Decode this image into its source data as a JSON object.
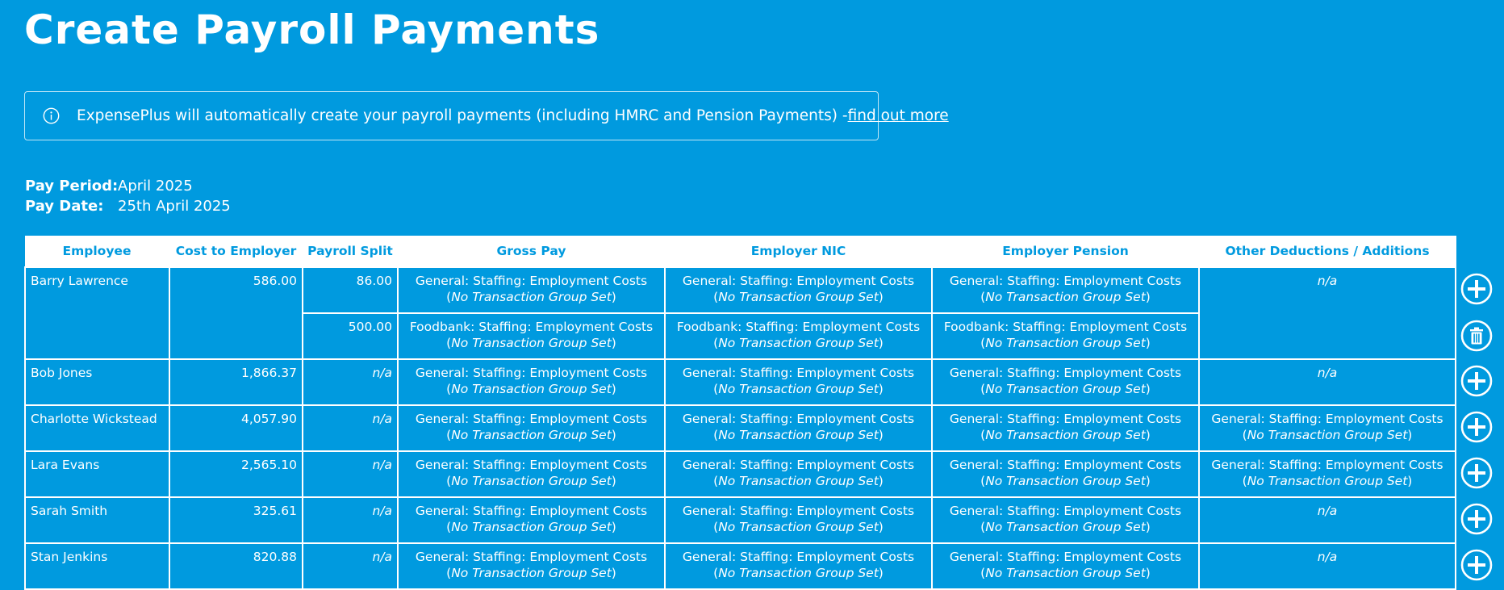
{
  "page": {
    "title": "Create Payroll Payments"
  },
  "banner": {
    "icon": "info-icon",
    "text": "ExpensePlus will automatically create your payroll payments (including HMRC and Pension Payments) - ",
    "link_text": "find out more"
  },
  "pay_info": {
    "period_label": "Pay Period:",
    "period_value": "April 2025",
    "date_label": "Pay Date:",
    "date_value": "25th April 2025"
  },
  "table": {
    "headers": {
      "employee": "Employee",
      "cost": "Cost to Employer",
      "split": "Payroll Split",
      "gross": "Gross Pay",
      "nic": "Employer NIC",
      "pension": "Employer Pension",
      "other": "Other Deductions / Additions"
    },
    "rows": [
      {
        "employee": "Barry Lawrence",
        "cost": "586.00",
        "other": "n/a",
        "splits": [
          {
            "amount": "86.00",
            "gross": "General: Staffing: Employment Costs",
            "gross_group": "No Transaction Group Set",
            "nic": "General: Staffing: Employment Costs",
            "nic_group": "No Transaction Group Set",
            "pension": "General: Staffing: Employment Costs",
            "pension_group": "No Transaction Group Set"
          },
          {
            "amount": "500.00",
            "gross": "Foodbank: Staffing: Employment Costs",
            "gross_group": "No Transaction Group Set",
            "nic": "Foodbank: Staffing: Employment Costs",
            "nic_group": "No Transaction Group Set",
            "pension": "Foodbank: Staffing: Employment Costs",
            "pension_group": "No Transaction Group Set"
          }
        ]
      },
      {
        "employee": "Bob Jones",
        "cost": "1,866.37",
        "split": "n/a",
        "gross": "General: Staffing: Employment Costs",
        "gross_group": "No Transaction Group Set",
        "nic": "General: Staffing: Employment Costs",
        "nic_group": "No Transaction Group Set",
        "pension": "General: Staffing: Employment Costs",
        "pension_group": "No Transaction Group Set",
        "other": "n/a"
      },
      {
        "employee": "Charlotte Wickstead",
        "cost": "4,057.90",
        "split": "n/a",
        "gross": "General: Staffing: Employment Costs",
        "gross_group": "No Transaction Group Set",
        "nic": "General: Staffing: Employment Costs",
        "nic_group": "No Transaction Group Set",
        "pension": "General: Staffing: Employment Costs",
        "pension_group": "No Transaction Group Set",
        "other": "General: Staffing: Employment Costs",
        "other_group": "No Transaction Group Set"
      },
      {
        "employee": "Lara Evans",
        "cost": "2,565.10",
        "split": "n/a",
        "gross": "General: Staffing: Employment Costs",
        "gross_group": "No Transaction Group Set",
        "nic": "General: Staffing: Employment Costs",
        "nic_group": "No Transaction Group Set",
        "pension": "General: Staffing: Employment Costs",
        "pension_group": "No Transaction Group Set",
        "other": "General: Staffing: Employment Costs",
        "other_group": "No Transaction Group Set"
      },
      {
        "employee": "Sarah Smith",
        "cost": "325.61",
        "split": "n/a",
        "gross": "General: Staffing: Employment Costs",
        "gross_group": "No Transaction Group Set",
        "nic": "General: Staffing: Employment Costs",
        "nic_group": "No Transaction Group Set",
        "pension": "General: Staffing: Employment Costs",
        "pension_group": "No Transaction Group Set",
        "other": "n/a"
      },
      {
        "employee": "Stan Jenkins",
        "cost": "820.88",
        "split": "n/a",
        "gross": "General: Staffing: Employment Costs",
        "gross_group": "No Transaction Group Set",
        "nic": "General: Staffing: Employment Costs",
        "nic_group": "No Transaction Group Set",
        "pension": "General: Staffing: Employment Costs",
        "pension_group": "No Transaction Group Set",
        "other": "n/a"
      }
    ]
  },
  "side_buttons": {
    "add_icon": "plus-circle-icon",
    "delete_icon": "trash-circle-icon"
  },
  "colors": {
    "background": "#009ADF",
    "header_bg": "#FFFFFF",
    "header_text": "#009ADF",
    "text": "#FFFFFF"
  }
}
